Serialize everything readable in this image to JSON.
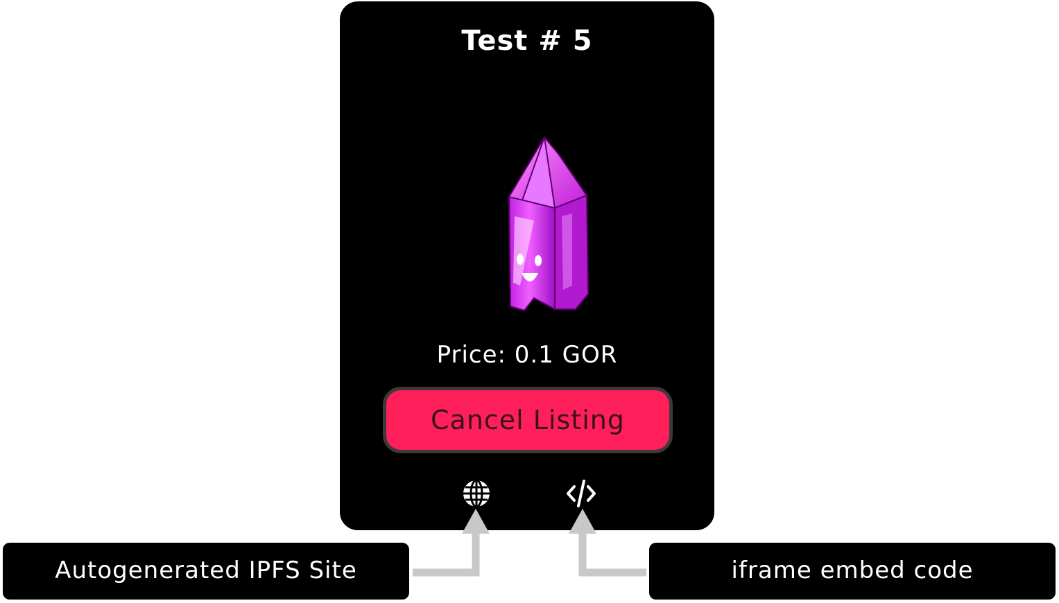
{
  "card": {
    "title": "Test # 5",
    "price": "Price: 0.1 GOR",
    "cancel_label": "Cancel Listing",
    "image_icon": "pink-crystal-icon",
    "link_icons": [
      "globe-icon",
      "code-brackets-icon"
    ]
  },
  "callouts": {
    "left": "Autogenerated IPFS Site",
    "right": "iframe embed code"
  },
  "colors": {
    "background": "#ffffff",
    "card": "#000000",
    "cancel_button": "#ff1f5a",
    "crystal": "#e040f0",
    "arrow": "#c8c8c8"
  }
}
